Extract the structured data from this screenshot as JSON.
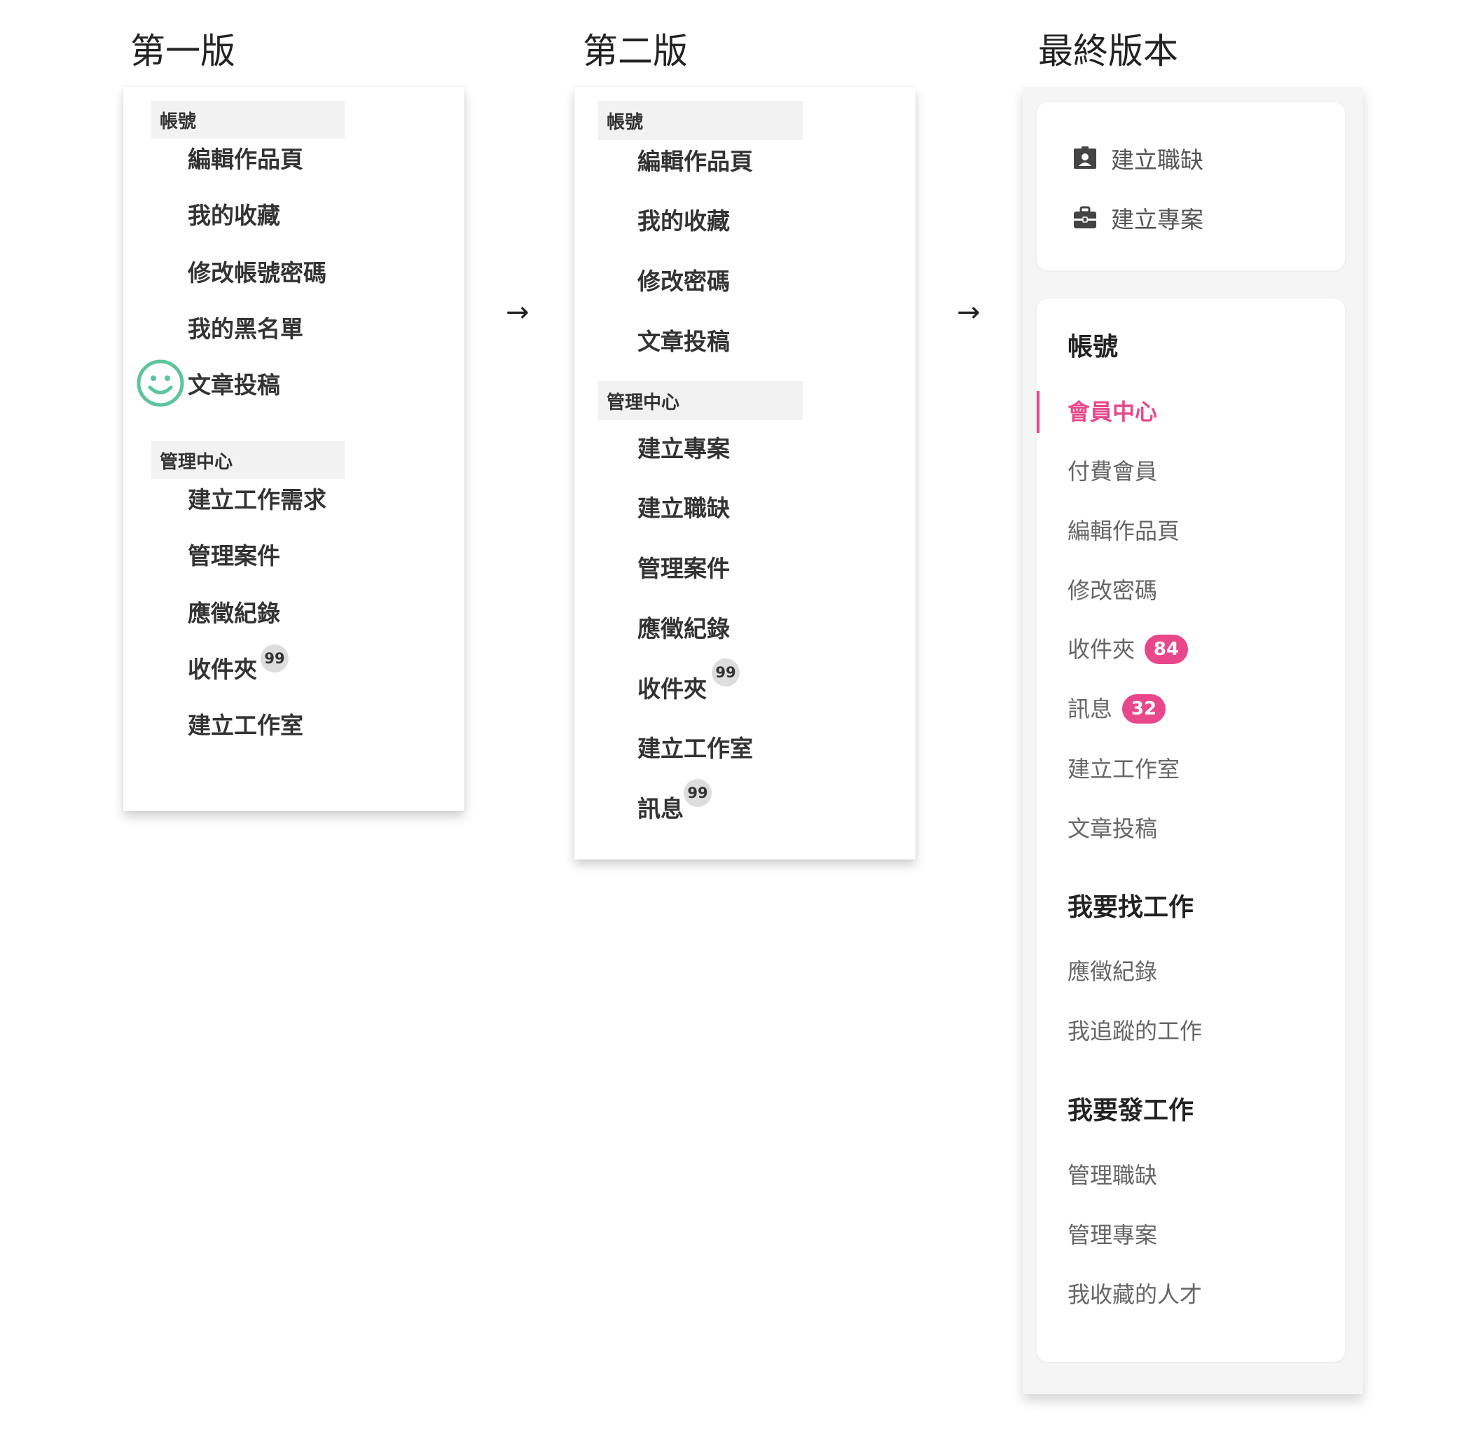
{
  "titles": {
    "v1": "第一版",
    "v2": "第二版",
    "final": "最終版本"
  },
  "arrow": "→",
  "v1": {
    "section1": "帳號",
    "items1": [
      "編輯作品頁",
      "我的收藏",
      "修改帳號密碼",
      "我的黑名單",
      "文章投稿"
    ],
    "section2": "管理中心",
    "items2": [
      "建立工作需求",
      "管理案件",
      "應徵紀錄",
      "收件夾",
      "建立工作室"
    ],
    "inbox_badge": "99"
  },
  "v2": {
    "section1": "帳號",
    "items1": [
      "編輯作品頁",
      "我的收藏",
      "修改密碼",
      "文章投稿"
    ],
    "section2": "管理中心",
    "items2": [
      "建立專案",
      "建立職缺",
      "管理案件",
      "應徵紀錄",
      "收件夾",
      "建立工作室",
      "訊息"
    ],
    "inbox_badge": "99",
    "message_badge": "99"
  },
  "final": {
    "top": [
      {
        "label": "建立職缺",
        "icon": "id-card-icon"
      },
      {
        "label": "建立專案",
        "icon": "briefcase-icon"
      }
    ],
    "account_head": "帳號",
    "account_items": [
      "會員中心",
      "付費會員",
      "編輯作品頁",
      "修改密碼",
      "收件夾",
      "訊息",
      "建立工作室",
      "文章投稿"
    ],
    "inbox_badge": "84",
    "message_badge": "32",
    "find_job_head": "我要找工作",
    "find_job_items": [
      "應徵紀錄",
      "我追蹤的工作"
    ],
    "post_job_head": "我要發工作",
    "post_job_items": [
      "管理職缺",
      "管理專案",
      "我收藏的人才"
    ],
    "accent_color": "#e8488b"
  },
  "colors": {
    "smiley": "#5cc49a",
    "badge_gray": "#dddddd",
    "section_bg": "#f2f2f2"
  }
}
